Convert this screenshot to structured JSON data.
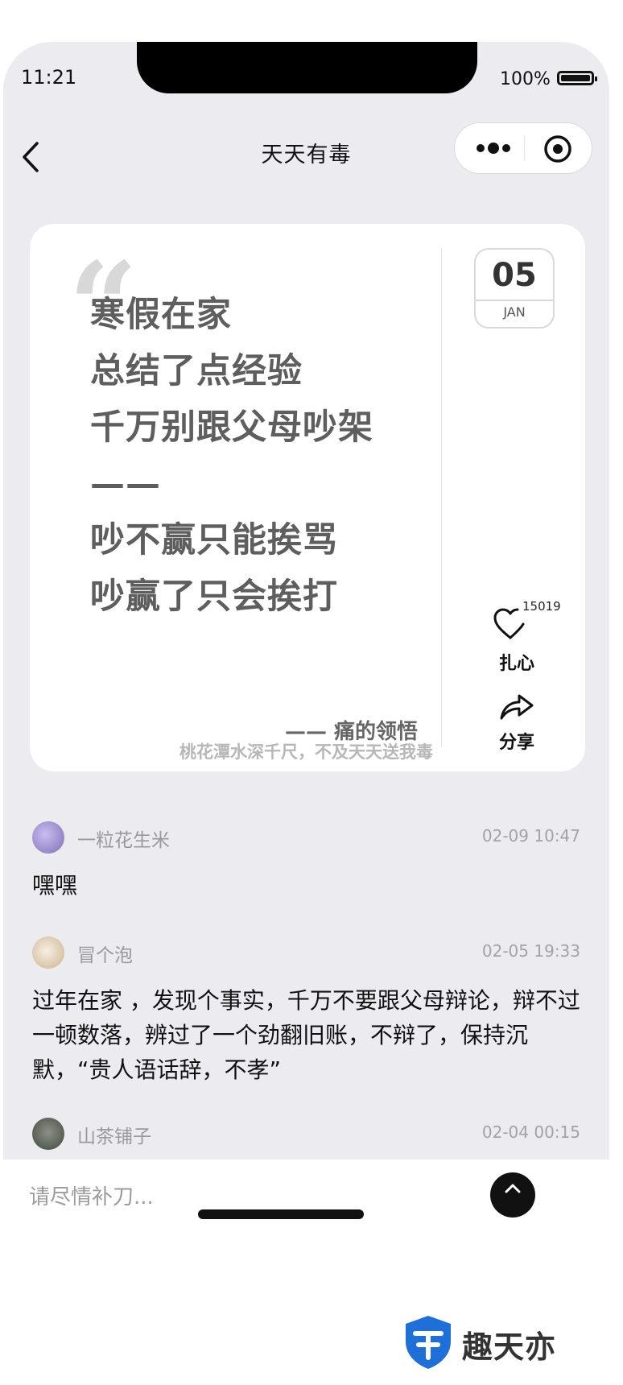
{
  "status_bar": {
    "time": "11:21",
    "battery": "100%"
  },
  "nav": {
    "title": "天天有毒"
  },
  "card": {
    "quote_lines": [
      "寒假在家",
      "总结了点经验",
      "千万别跟父母吵架",
      "——",
      "吵不赢只能挨骂",
      "吵赢了只会挨打"
    ],
    "author": "—— 痛的领悟",
    "date": {
      "day": "05",
      "month": "JAN"
    },
    "like": {
      "count": "15019",
      "label": "扎心"
    },
    "share": {
      "label": "分享"
    }
  },
  "tagline": "桃花潭水深千尺，不及天天送我毒",
  "comments": [
    {
      "name": "一粒花生米",
      "time": "02-09 10:47",
      "text": "嘿嘿",
      "avatar_color": "#8b7fc4"
    },
    {
      "name": "冒个泡",
      "time": "02-05 19:33",
      "text": "过年在家 ，发现个事实，千万不要跟父母辩论，辩不过一顿数落，辨过了一个劲翻旧账，不辩了，保持沉默，“贵人语话辞，不孝”",
      "avatar_color": "#d9c3a5"
    },
    {
      "name": "山茶铺子",
      "time": "02-04 00:15",
      "text": "",
      "avatar_color": "#5b6b57"
    }
  ],
  "input": {
    "placeholder": "请尽情补刀..."
  },
  "watermark": {
    "text": "趣天亦"
  }
}
